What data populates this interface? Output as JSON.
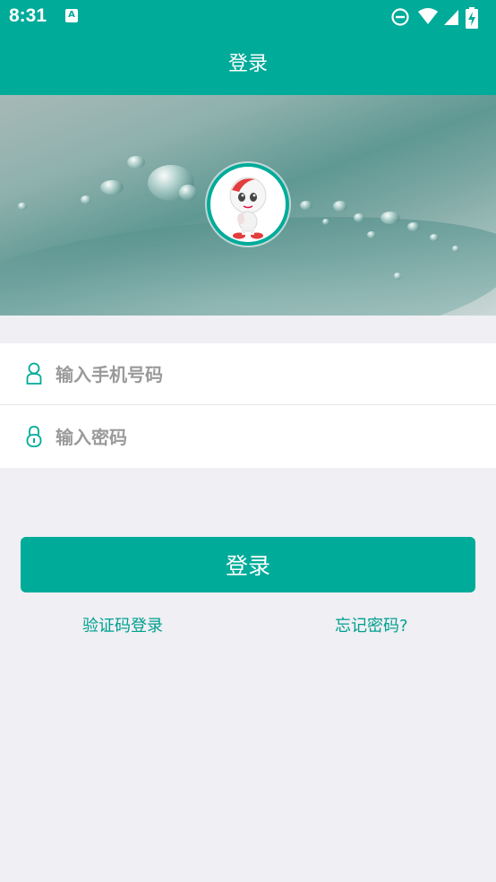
{
  "status_bar": {
    "time": "8:31",
    "notification_icon": "text-a-icon",
    "icons": [
      "do-not-disturb-icon",
      "wifi-icon",
      "signal-icon",
      "battery-charging-icon"
    ]
  },
  "header": {
    "title": "登录"
  },
  "banner": {
    "image": "water-drops-on-leaf",
    "avatar": "robot-mascot-avatar"
  },
  "form": {
    "phone": {
      "placeholder": "输入手机号码",
      "value": "",
      "icon": "user-icon"
    },
    "password": {
      "placeholder": "输入密码",
      "value": "",
      "icon": "lock-icon"
    }
  },
  "actions": {
    "login_label": "登录",
    "sms_login_label": "验证码登录",
    "forgot_password_label": "忘记密码?"
  },
  "colors": {
    "accent": "#00ab9a",
    "background": "#efeff4",
    "link": "#00a08f",
    "placeholder": "#9a9a9a"
  }
}
